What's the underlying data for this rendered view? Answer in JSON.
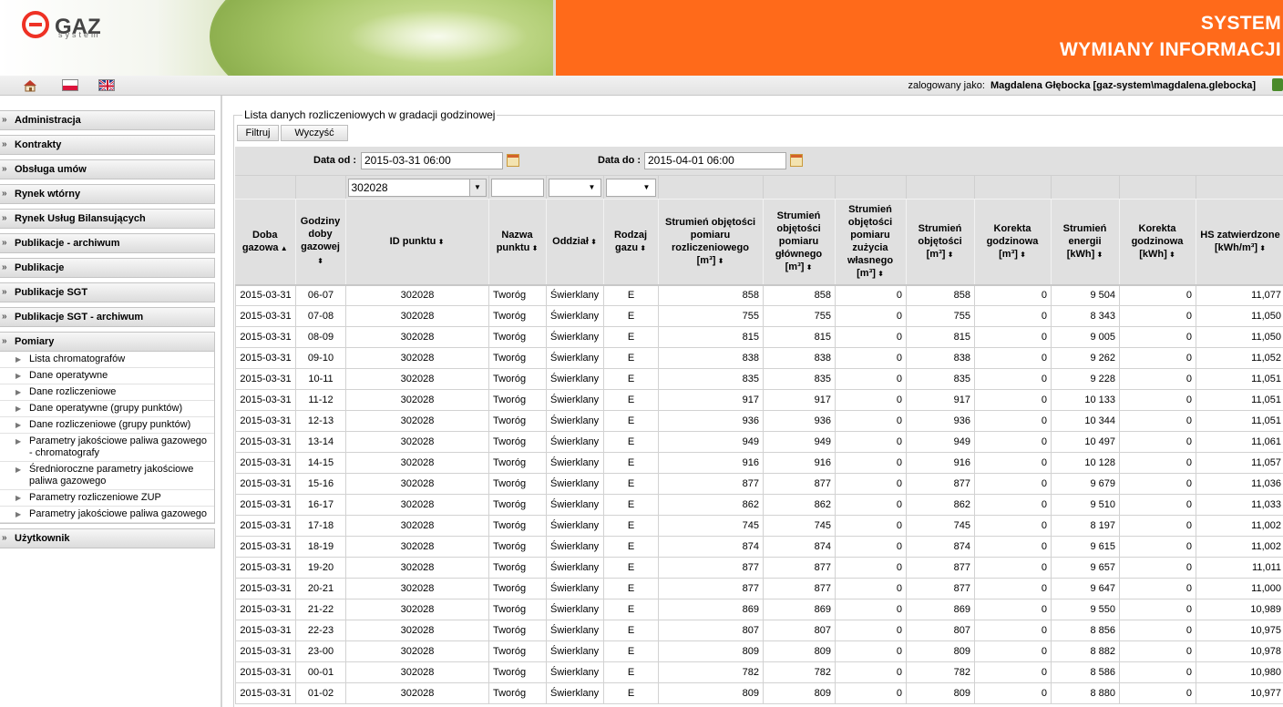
{
  "header": {
    "logo_text": "GAZ",
    "logo_sub": "system",
    "title_line1": "SYSTEM",
    "title_line2": "WYMIANY INFORMACJI"
  },
  "topbar": {
    "logged_label": "zalogowany jako:",
    "user": "Magdalena Głębocka [gaz-system\\magdalena.glebocka]"
  },
  "sidebar": {
    "menu": [
      {
        "label": "Administracja"
      },
      {
        "label": "Kontrakty"
      },
      {
        "label": "Obsługa umów"
      },
      {
        "label": "Rynek wtórny"
      },
      {
        "label": "Rynek Usług Bilansujących"
      },
      {
        "label": "Publikacje - archiwum"
      },
      {
        "label": "Publikacje"
      },
      {
        "label": "Publikacje SGT"
      },
      {
        "label": "Publikacje SGT - archiwum"
      },
      {
        "label": "Pomiary"
      }
    ],
    "pomiary_items": [
      "Lista chromatografów",
      "Dane operatywne",
      "Dane rozliczeniowe",
      "Dane operatywne (grupy punktów)",
      "Dane rozliczeniowe (grupy punktów)",
      "Parametry jakościowe paliwa gazowego - chromatografy",
      "Średnioroczne parametry jakościowe paliwa gazowego",
      "Parametry rozliczeniowe ZUP",
      "Parametry jakościowe paliwa gazowego"
    ],
    "last_menu": "Użytkownik"
  },
  "main": {
    "legend": "Lista danych rozliczeniowych w gradacji godzinowej",
    "btn_filter": "Filtruj",
    "btn_clear": "Wyczyść",
    "date_from_label": "Data od :",
    "date_from": "2015-03-31 06:00",
    "date_to_label": "Data do :",
    "date_to": "2015-04-01 06:00",
    "point_filter": "302028"
  },
  "columns": [
    "Doba gazowa",
    "Godziny doby gazowej",
    "ID punktu",
    "Nazwa punktu",
    "Oddział",
    "Rodzaj gazu",
    "Strumień objętości pomiaru rozliczeniowego [m³]",
    "Strumień objętości pomiaru głównego [m³]",
    "Strumień objętości pomiaru zużycia własnego [m³]",
    "Strumień objętości [m³]",
    "Korekta godzinowa [m³]",
    "Strumień energii [kWh]",
    "Korekta godzinowa [kWh]",
    "HS zatwierdzone [kWh/m³]"
  ],
  "rows": [
    [
      "2015-03-31",
      "06-07",
      "302028",
      "Tworóg",
      "Świerklany",
      "E",
      "858",
      "858",
      "0",
      "858",
      "0",
      "9 504",
      "0",
      "11,077"
    ],
    [
      "2015-03-31",
      "07-08",
      "302028",
      "Tworóg",
      "Świerklany",
      "E",
      "755",
      "755",
      "0",
      "755",
      "0",
      "8 343",
      "0",
      "11,050"
    ],
    [
      "2015-03-31",
      "08-09",
      "302028",
      "Tworóg",
      "Świerklany",
      "E",
      "815",
      "815",
      "0",
      "815",
      "0",
      "9 005",
      "0",
      "11,050"
    ],
    [
      "2015-03-31",
      "09-10",
      "302028",
      "Tworóg",
      "Świerklany",
      "E",
      "838",
      "838",
      "0",
      "838",
      "0",
      "9 262",
      "0",
      "11,052"
    ],
    [
      "2015-03-31",
      "10-11",
      "302028",
      "Tworóg",
      "Świerklany",
      "E",
      "835",
      "835",
      "0",
      "835",
      "0",
      "9 228",
      "0",
      "11,051"
    ],
    [
      "2015-03-31",
      "11-12",
      "302028",
      "Tworóg",
      "Świerklany",
      "E",
      "917",
      "917",
      "0",
      "917",
      "0",
      "10 133",
      "0",
      "11,051"
    ],
    [
      "2015-03-31",
      "12-13",
      "302028",
      "Tworóg",
      "Świerklany",
      "E",
      "936",
      "936",
      "0",
      "936",
      "0",
      "10 344",
      "0",
      "11,051"
    ],
    [
      "2015-03-31",
      "13-14",
      "302028",
      "Tworóg",
      "Świerklany",
      "E",
      "949",
      "949",
      "0",
      "949",
      "0",
      "10 497",
      "0",
      "11,061"
    ],
    [
      "2015-03-31",
      "14-15",
      "302028",
      "Tworóg",
      "Świerklany",
      "E",
      "916",
      "916",
      "0",
      "916",
      "0",
      "10 128",
      "0",
      "11,057"
    ],
    [
      "2015-03-31",
      "15-16",
      "302028",
      "Tworóg",
      "Świerklany",
      "E",
      "877",
      "877",
      "0",
      "877",
      "0",
      "9 679",
      "0",
      "11,036"
    ],
    [
      "2015-03-31",
      "16-17",
      "302028",
      "Tworóg",
      "Świerklany",
      "E",
      "862",
      "862",
      "0",
      "862",
      "0",
      "9 510",
      "0",
      "11,033"
    ],
    [
      "2015-03-31",
      "17-18",
      "302028",
      "Tworóg",
      "Świerklany",
      "E",
      "745",
      "745",
      "0",
      "745",
      "0",
      "8 197",
      "0",
      "11,002"
    ],
    [
      "2015-03-31",
      "18-19",
      "302028",
      "Tworóg",
      "Świerklany",
      "E",
      "874",
      "874",
      "0",
      "874",
      "0",
      "9 615",
      "0",
      "11,002"
    ],
    [
      "2015-03-31",
      "19-20",
      "302028",
      "Tworóg",
      "Świerklany",
      "E",
      "877",
      "877",
      "0",
      "877",
      "0",
      "9 657",
      "0",
      "11,011"
    ],
    [
      "2015-03-31",
      "20-21",
      "302028",
      "Tworóg",
      "Świerklany",
      "E",
      "877",
      "877",
      "0",
      "877",
      "0",
      "9 647",
      "0",
      "11,000"
    ],
    [
      "2015-03-31",
      "21-22",
      "302028",
      "Tworóg",
      "Świerklany",
      "E",
      "869",
      "869",
      "0",
      "869",
      "0",
      "9 550",
      "0",
      "10,989"
    ],
    [
      "2015-03-31",
      "22-23",
      "302028",
      "Tworóg",
      "Świerklany",
      "E",
      "807",
      "807",
      "0",
      "807",
      "0",
      "8 856",
      "0",
      "10,975"
    ],
    [
      "2015-03-31",
      "23-00",
      "302028",
      "Tworóg",
      "Świerklany",
      "E",
      "809",
      "809",
      "0",
      "809",
      "0",
      "8 882",
      "0",
      "10,978"
    ],
    [
      "2015-03-31",
      "00-01",
      "302028",
      "Tworóg",
      "Świerklany",
      "E",
      "782",
      "782",
      "0",
      "782",
      "0",
      "8 586",
      "0",
      "10,980"
    ],
    [
      "2015-03-31",
      "01-02",
      "302028",
      "Tworóg",
      "Świerklany",
      "E",
      "809",
      "809",
      "0",
      "809",
      "0",
      "8 880",
      "0",
      "10,977"
    ]
  ]
}
